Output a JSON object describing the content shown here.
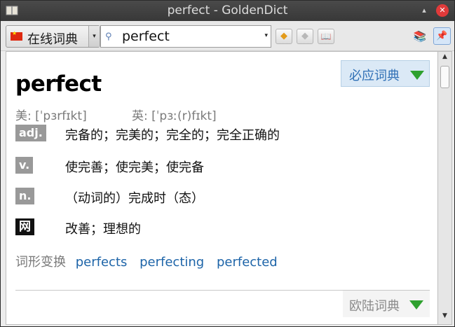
{
  "window": {
    "title": "perfect - GoldenDict",
    "up_glyph": "▴",
    "close_glyph": "✕"
  },
  "toolbar": {
    "group_label": "在线词典",
    "group_arrow": "▾",
    "search_icon": "⚲",
    "search_value": "perfect",
    "search_arrow": "▾",
    "back_glyph": "◆",
    "forward_glyph": "◆",
    "book_glyph": "📖",
    "dicts_glyph": "📚",
    "pin_glyph": "📌"
  },
  "article": {
    "headword": "perfect",
    "dict_name": "必应词典",
    "phonetic_us": "美: [ˈpɜrfɪkt]",
    "phonetic_uk": "英: [ˈpɜː(r)fɪkt]",
    "definitions": [
      {
        "pos": "adj.",
        "meaning": "完备的；完美的；完全的；完全正确的"
      },
      {
        "pos": "v.",
        "meaning": "使完善；使完美；使完备"
      },
      {
        "pos": "n.",
        "meaning": "（动词的）完成时（态）"
      },
      {
        "pos": "网络",
        "meaning": "改善；理想的"
      }
    ],
    "forms_label": "词形变换",
    "forms": [
      "perfects",
      "perfecting",
      "perfected"
    ],
    "footer_dict": "欧陆词典"
  },
  "scrollbar": {
    "up_glyph": "▲",
    "down_glyph": "▼"
  },
  "colors": {
    "accent_green": "#2ea12e",
    "link_blue": "#1d64a8",
    "close_red": "#e03a3a"
  }
}
